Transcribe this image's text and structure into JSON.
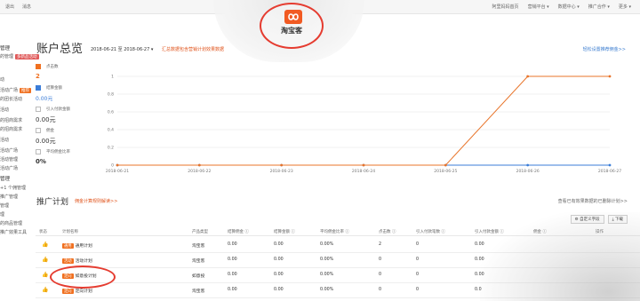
{
  "topbar": {
    "left": [
      "退出",
      "消息"
    ],
    "right": [
      "阿里妈妈首页",
      "营销平台 ▾",
      "数据中心 ▾",
      "推广合作 ▾",
      "更多 ▾"
    ]
  },
  "logo": {
    "text": "淘宝客"
  },
  "sidebar": {
    "items": [
      {
        "text": "管理",
        "badge": ""
      },
      {
        "text": "的管理",
        "badge": "多新品活动"
      },
      {
        "text": "动",
        "badge": ""
      },
      {
        "text": "活动广场",
        "badge": "推荐"
      },
      {
        "text": "的团长活动",
        "badge": ""
      },
      {
        "text": "活动",
        "badge": ""
      },
      {
        "text": "的招商需求",
        "badge": ""
      },
      {
        "text": "的招商需求",
        "badge": ""
      },
      {
        "text": "活动",
        "badge": ""
      },
      {
        "text": "活动广场",
        "badge": ""
      },
      {
        "text": "活动管理",
        "badge": ""
      },
      {
        "text": "活动广场",
        "badge": ""
      },
      {
        "text": "管理",
        "badge": ""
      },
      {
        "text": "+1 个佣管理",
        "badge": ""
      },
      {
        "text": "推广管理",
        "badge": ""
      },
      {
        "text": "管理",
        "badge": ""
      },
      {
        "text": "理",
        "badge": ""
      },
      {
        "text": "的商品管理",
        "badge": ""
      },
      {
        "text": "推广效果工具",
        "badge": ""
      }
    ]
  },
  "header": {
    "title": "账户总览",
    "date_range": "2018-06-21 至 2018-06-27 ▾",
    "date_note": "汇总数据包含营销计划效果数据",
    "top_link": "轻松设置推荐佣金>>"
  },
  "metrics": [
    {
      "label": "点击数",
      "value": "2",
      "checked": true,
      "color": "orange"
    },
    {
      "label": "结算金额",
      "value": "0.00元",
      "checked": true,
      "color": "blue"
    },
    {
      "label": "引入付款金额",
      "value": "0.00元",
      "checked": false,
      "color": ""
    },
    {
      "label": "佣金",
      "value": "0.00元",
      "checked": false,
      "color": ""
    },
    {
      "label": "平均佣金比率",
      "value": "0%",
      "checked": false,
      "color": "bold"
    }
  ],
  "chart_data": {
    "type": "line",
    "x": [
      "2018-06-21",
      "2018-06-22",
      "2018-06-23",
      "2018-06-24",
      "2018-06-25",
      "2018-06-26",
      "2018-06-27"
    ],
    "y_ticks": [
      "0",
      "0.2",
      "0.4",
      "0.6",
      "0.8",
      "1"
    ],
    "ylim": [
      0,
      1
    ],
    "grid": true,
    "series": [
      {
        "name": "点击数",
        "color": "#e8742a",
        "values": [
          0,
          0,
          0,
          0,
          0,
          1,
          1
        ]
      },
      {
        "name": "结算金额",
        "color": "#3b7dd8",
        "values": [
          0,
          0,
          0,
          0,
          0,
          0,
          0
        ]
      }
    ]
  },
  "plans": {
    "title": "推广计划",
    "rules_link": "佣金计算规则解读>>",
    "right_link": "查看已有效果数据的已删除计划>>",
    "tools": [
      "⚙ 自定义字段",
      "⤓ 下载"
    ],
    "columns": [
      "状态",
      "计划名称",
      "产品类型",
      "结算佣金 ⓘ",
      "结算金额 ⓘ",
      "平均佣金比率 ⓘ",
      "点击数 ⓘ",
      "引入付款笔数 ⓘ",
      "引入付款金额 ⓘ",
      "佣金 ⓘ",
      "操作"
    ],
    "rows": [
      {
        "badge": "通用",
        "name": "通用计划",
        "type": "淘宝客",
        "commission": "0.00",
        "amount": "0.00",
        "rate": "0.00%",
        "clicks": "2",
        "orders": "0",
        "pay": "0.00"
      },
      {
        "badge": "活动",
        "name": "活动计划",
        "type": "淘宝客",
        "commission": "0.00",
        "amount": "0.00",
        "rate": "0.00%",
        "clicks": "0",
        "orders": "0",
        "pay": "0.00"
      },
      {
        "badge": "定向",
        "name": "如意投计划",
        "type": "如意投",
        "commission": "0.00",
        "amount": "0.00",
        "rate": "0.00%",
        "clicks": "0",
        "orders": "0",
        "pay": "0.00"
      },
      {
        "badge": "定向",
        "name": "定向计划",
        "type": "淘宝客",
        "commission": "0.00",
        "amount": "0.00",
        "rate": "0.00%",
        "clicks": "0",
        "orders": "0",
        "pay": "0.0"
      }
    ]
  }
}
